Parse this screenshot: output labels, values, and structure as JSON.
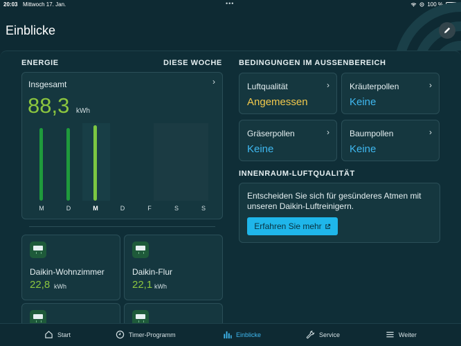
{
  "status": {
    "time": "20:03",
    "date": "Mittwoch 17. Jan.",
    "battery": "100 %",
    "dots": "•••"
  },
  "header": {
    "title": "Einblicke"
  },
  "energy": {
    "section_label": "ENERGIE",
    "period": "DIESE WOCHE",
    "card_label": "Insgesamt",
    "total": "88,3",
    "unit": "kWh",
    "current_day_index": 2,
    "days": [
      "M",
      "D",
      "M",
      "D",
      "F",
      "S",
      "S"
    ]
  },
  "chart_data": {
    "type": "bar",
    "categories": [
      "M",
      "D",
      "M",
      "D",
      "F",
      "S",
      "S"
    ],
    "values": [
      32,
      32,
      33,
      0,
      0,
      0,
      0
    ],
    "title": "",
    "xlabel": "",
    "ylabel": "",
    "grid": false,
    "legend": "none"
  },
  "devices": [
    {
      "name": "Daikin-Wohnzimmer",
      "value": "22,8",
      "unit": "kWh"
    },
    {
      "name": "Daikin-Flur",
      "value": "22,1",
      "unit": "kWh"
    }
  ],
  "conditions": {
    "section_label": "BEDINGUNGEN IM AUSSENBEREICH",
    "items": [
      {
        "label": "Luftqualität",
        "value": "Angemessen",
        "color": "#f2c94c"
      },
      {
        "label": "Kräuterpollen",
        "value": "Keine",
        "color": "#3fb8f0"
      },
      {
        "label": "Gräserpollen",
        "value": "Keine",
        "color": "#3fb8f0"
      },
      {
        "label": "Baumpollen",
        "value": "Keine",
        "color": "#3fb8f0"
      }
    ]
  },
  "indoor": {
    "section_label": "INNENRAUM-LUFTQUALITÄT",
    "text": "Entscheiden Sie sich für gesünderes Atmen mit unseren Daikin-Luftreinigern.",
    "cta": "Erfahren Sie mehr"
  },
  "tabs": [
    {
      "label": "Start",
      "icon": "home-icon"
    },
    {
      "label": "Timer-Programm",
      "icon": "clock-icon"
    },
    {
      "label": "Einblicke",
      "icon": "bar-chart-icon",
      "active": true
    },
    {
      "label": "Service",
      "icon": "wrench-icon"
    },
    {
      "label": "Weiter",
      "icon": "menu-icon"
    }
  ],
  "colors": {
    "accent": "#3fb8f0",
    "energy": "#8cc63f",
    "bar": "#1f9a3c",
    "bar_current": "#7cc642",
    "warning": "#f2c94c"
  }
}
